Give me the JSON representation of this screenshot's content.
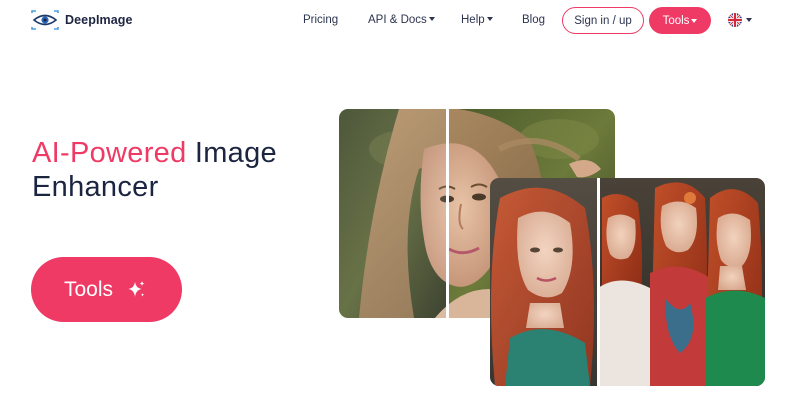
{
  "header": {
    "brand": "DeepImage",
    "nav": {
      "pricing": "Pricing",
      "api_docs": "API & Docs",
      "help": "Help",
      "blog": "Blog"
    },
    "signin_label": "Sign in / up",
    "tools_label": "Tools",
    "language": "en-GB"
  },
  "hero": {
    "title_accent": "AI-Powered",
    "title_line1_rest": " Image",
    "title_line2": "Enhancer",
    "button_label": "Tools"
  },
  "colors": {
    "accent": "#ef3a66",
    "text_dark": "#1c2540",
    "background": "#ffffff"
  },
  "icons": {
    "logo": "eye-logo-icon",
    "language": "uk-flag-icon",
    "button": "sparkle-icon"
  }
}
